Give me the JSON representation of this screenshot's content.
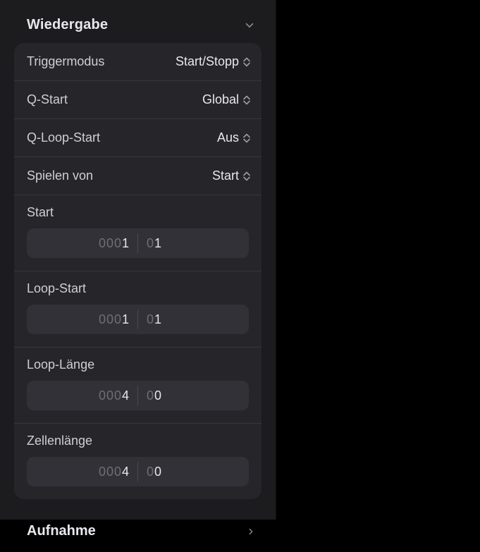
{
  "sections": {
    "wiedergabe": {
      "title": "Wiedergabe"
    },
    "aufnahme": {
      "title": "Aufnahme"
    }
  },
  "popups": {
    "triggermodus": {
      "label": "Triggermodus",
      "value": "Start/Stopp"
    },
    "qstart": {
      "label": "Q-Start",
      "value": "Global"
    },
    "qloopstart": {
      "label": "Q-Loop-Start",
      "value": "Aus"
    },
    "spielenvon": {
      "label": "Spielen von",
      "value": "Start"
    }
  },
  "fields": {
    "start": {
      "label": "Start",
      "bars_pad": "000",
      "bars": "1",
      "beats_pad": "0",
      "beats": "1"
    },
    "loopstart": {
      "label": "Loop-Start",
      "bars_pad": "000",
      "bars": "1",
      "beats_pad": "0",
      "beats": "1"
    },
    "looplaenge": {
      "label": "Loop-Länge",
      "bars_pad": "000",
      "bars": "4",
      "beats_pad": "0",
      "beats": "0"
    },
    "zellen": {
      "label": "Zellenlänge",
      "bars_pad": "000",
      "bars": "4",
      "beats_pad": "0",
      "beats": "0"
    }
  }
}
